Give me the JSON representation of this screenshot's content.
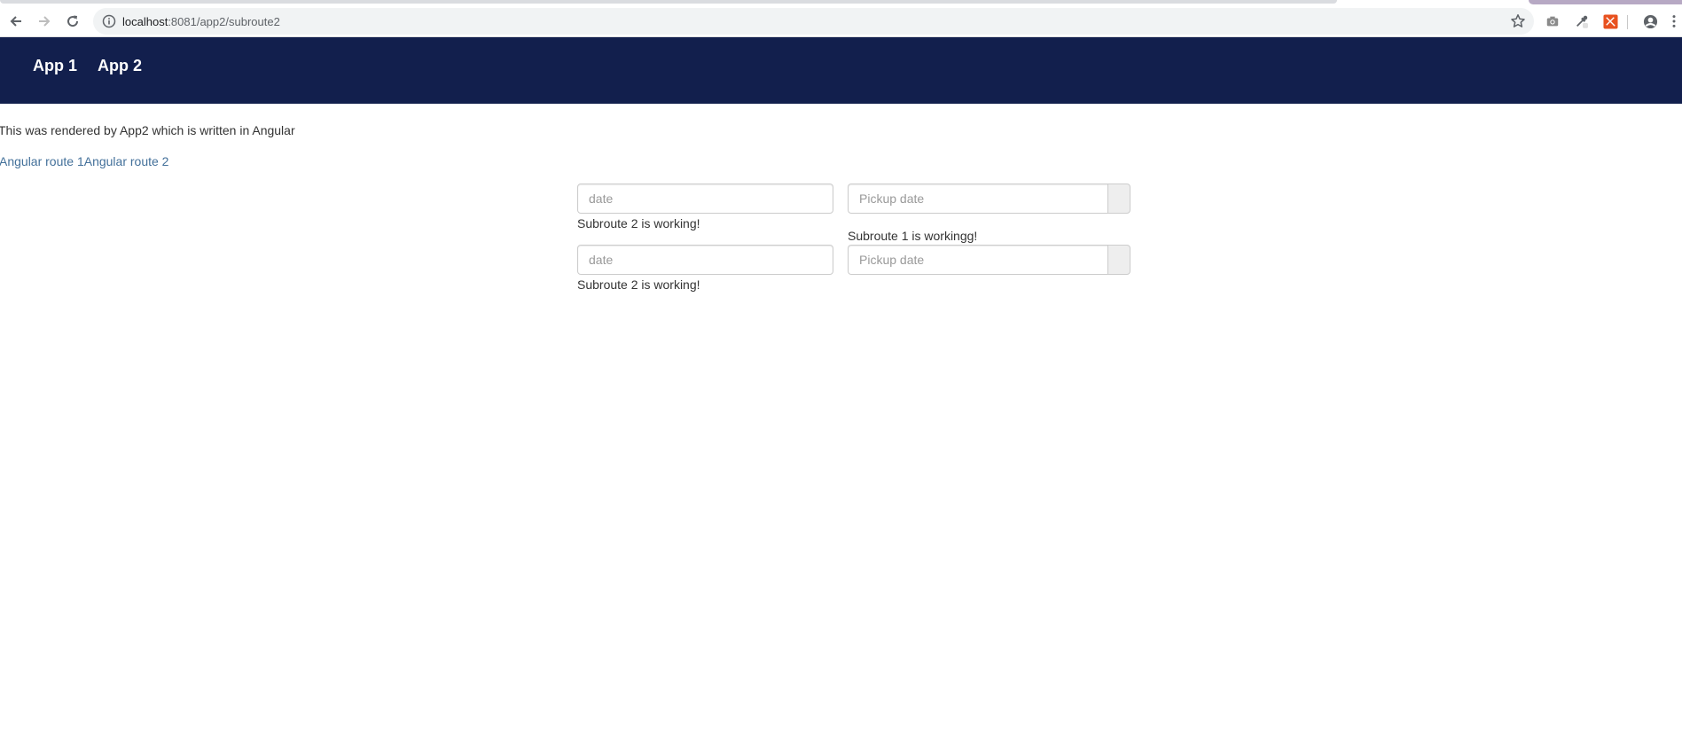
{
  "browser": {
    "url_host": "localhost",
    "url_path": ":8081/app2/subroute2"
  },
  "header": {
    "nav": [
      {
        "label": "App 1"
      },
      {
        "label": "App 2"
      }
    ]
  },
  "main": {
    "rendered_by": "This was rendered by App2 which is written in Angular",
    "routes": [
      {
        "label": "Angular route 1"
      },
      {
        "label": "Angular route 2"
      }
    ],
    "rows": [
      {
        "date_placeholder": "date",
        "date_status": "Subroute 2 is working!",
        "pickup_placeholder": "Pickup date",
        "pickup_status": "Subroute 1 is workingg!"
      },
      {
        "date_placeholder": "date",
        "date_status": "Subroute 2 is working!",
        "pickup_placeholder": "Pickup date"
      }
    ]
  },
  "colors": {
    "header_bg": "#121f4d",
    "link": "#43709a",
    "text": "#333333"
  }
}
